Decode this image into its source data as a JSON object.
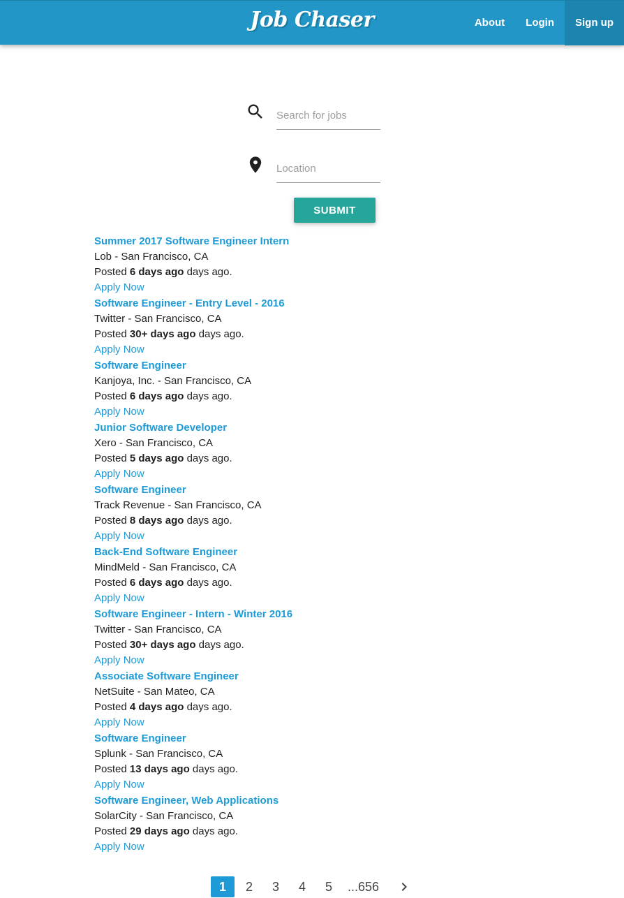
{
  "brand": "Job Chaser",
  "nav": {
    "about": "About",
    "login": "Login",
    "signup": "Sign up"
  },
  "search": {
    "jobs_placeholder": "Search for jobs",
    "jobs_value": "",
    "location_placeholder": "Location",
    "location_value": "",
    "submit_label": "SUBMIT",
    "search_icon": "search-icon",
    "location_icon": "location-pin-icon"
  },
  "jobs": [
    {
      "title": "Summer 2017 Software Engineer Intern",
      "company_location": "Lob - San Francisco, CA",
      "posted_prefix": "Posted ",
      "posted_age": "6 days ago",
      "posted_suffix": " days ago.",
      "apply": "Apply Now"
    },
    {
      "title": "Software Engineer - Entry Level - 2016",
      "company_location": "Twitter - San Francisco, CA",
      "posted_prefix": "Posted ",
      "posted_age": "30+ days ago",
      "posted_suffix": " days ago.",
      "apply": "Apply Now"
    },
    {
      "title": "Software Engineer",
      "company_location": "Kanjoya, Inc. - San Francisco, CA",
      "posted_prefix": "Posted ",
      "posted_age": "6 days ago",
      "posted_suffix": " days ago.",
      "apply": "Apply Now"
    },
    {
      "title": "Junior Software Developer",
      "company_location": "Xero - San Francisco, CA",
      "posted_prefix": "Posted ",
      "posted_age": "5 days ago",
      "posted_suffix": " days ago.",
      "apply": "Apply Now"
    },
    {
      "title": "Software Engineer",
      "company_location": "Track Revenue - San Francisco, CA",
      "posted_prefix": "Posted ",
      "posted_age": "8 days ago",
      "posted_suffix": " days ago.",
      "apply": "Apply Now"
    },
    {
      "title": "Back-End Software Engineer",
      "company_location": "MindMeld - San Francisco, CA",
      "posted_prefix": "Posted ",
      "posted_age": "6 days ago",
      "posted_suffix": " days ago.",
      "apply": "Apply Now"
    },
    {
      "title": "Software Engineer - Intern - Winter 2016",
      "company_location": "Twitter - San Francisco, CA",
      "posted_prefix": "Posted ",
      "posted_age": "30+ days ago",
      "posted_suffix": " days ago.",
      "apply": "Apply Now"
    },
    {
      "title": "Associate Software Engineer",
      "company_location": "NetSuite - San Mateo, CA",
      "posted_prefix": "Posted ",
      "posted_age": "4 days ago",
      "posted_suffix": " days ago.",
      "apply": "Apply Now"
    },
    {
      "title": "Software Engineer",
      "company_location": "Splunk - San Francisco, CA",
      "posted_prefix": "Posted ",
      "posted_age": "13 days ago",
      "posted_suffix": " days ago.",
      "apply": "Apply Now"
    },
    {
      "title": "Software Engineer, Web Applications",
      "company_location": "SolarCity - San Francisco, CA",
      "posted_prefix": "Posted ",
      "posted_age": "29 days ago",
      "posted_suffix": " days ago.",
      "apply": "Apply Now"
    }
  ],
  "pagination": {
    "pages": [
      "1",
      "2",
      "3",
      "4",
      "5"
    ],
    "current": "1",
    "last": "...656",
    "next_icon": "chevron-right-icon"
  },
  "colors": {
    "navbar": "#2196c7",
    "navbar_active": "#1d84b0",
    "link": "#1e9bd7",
    "submit": "#26a69a"
  }
}
